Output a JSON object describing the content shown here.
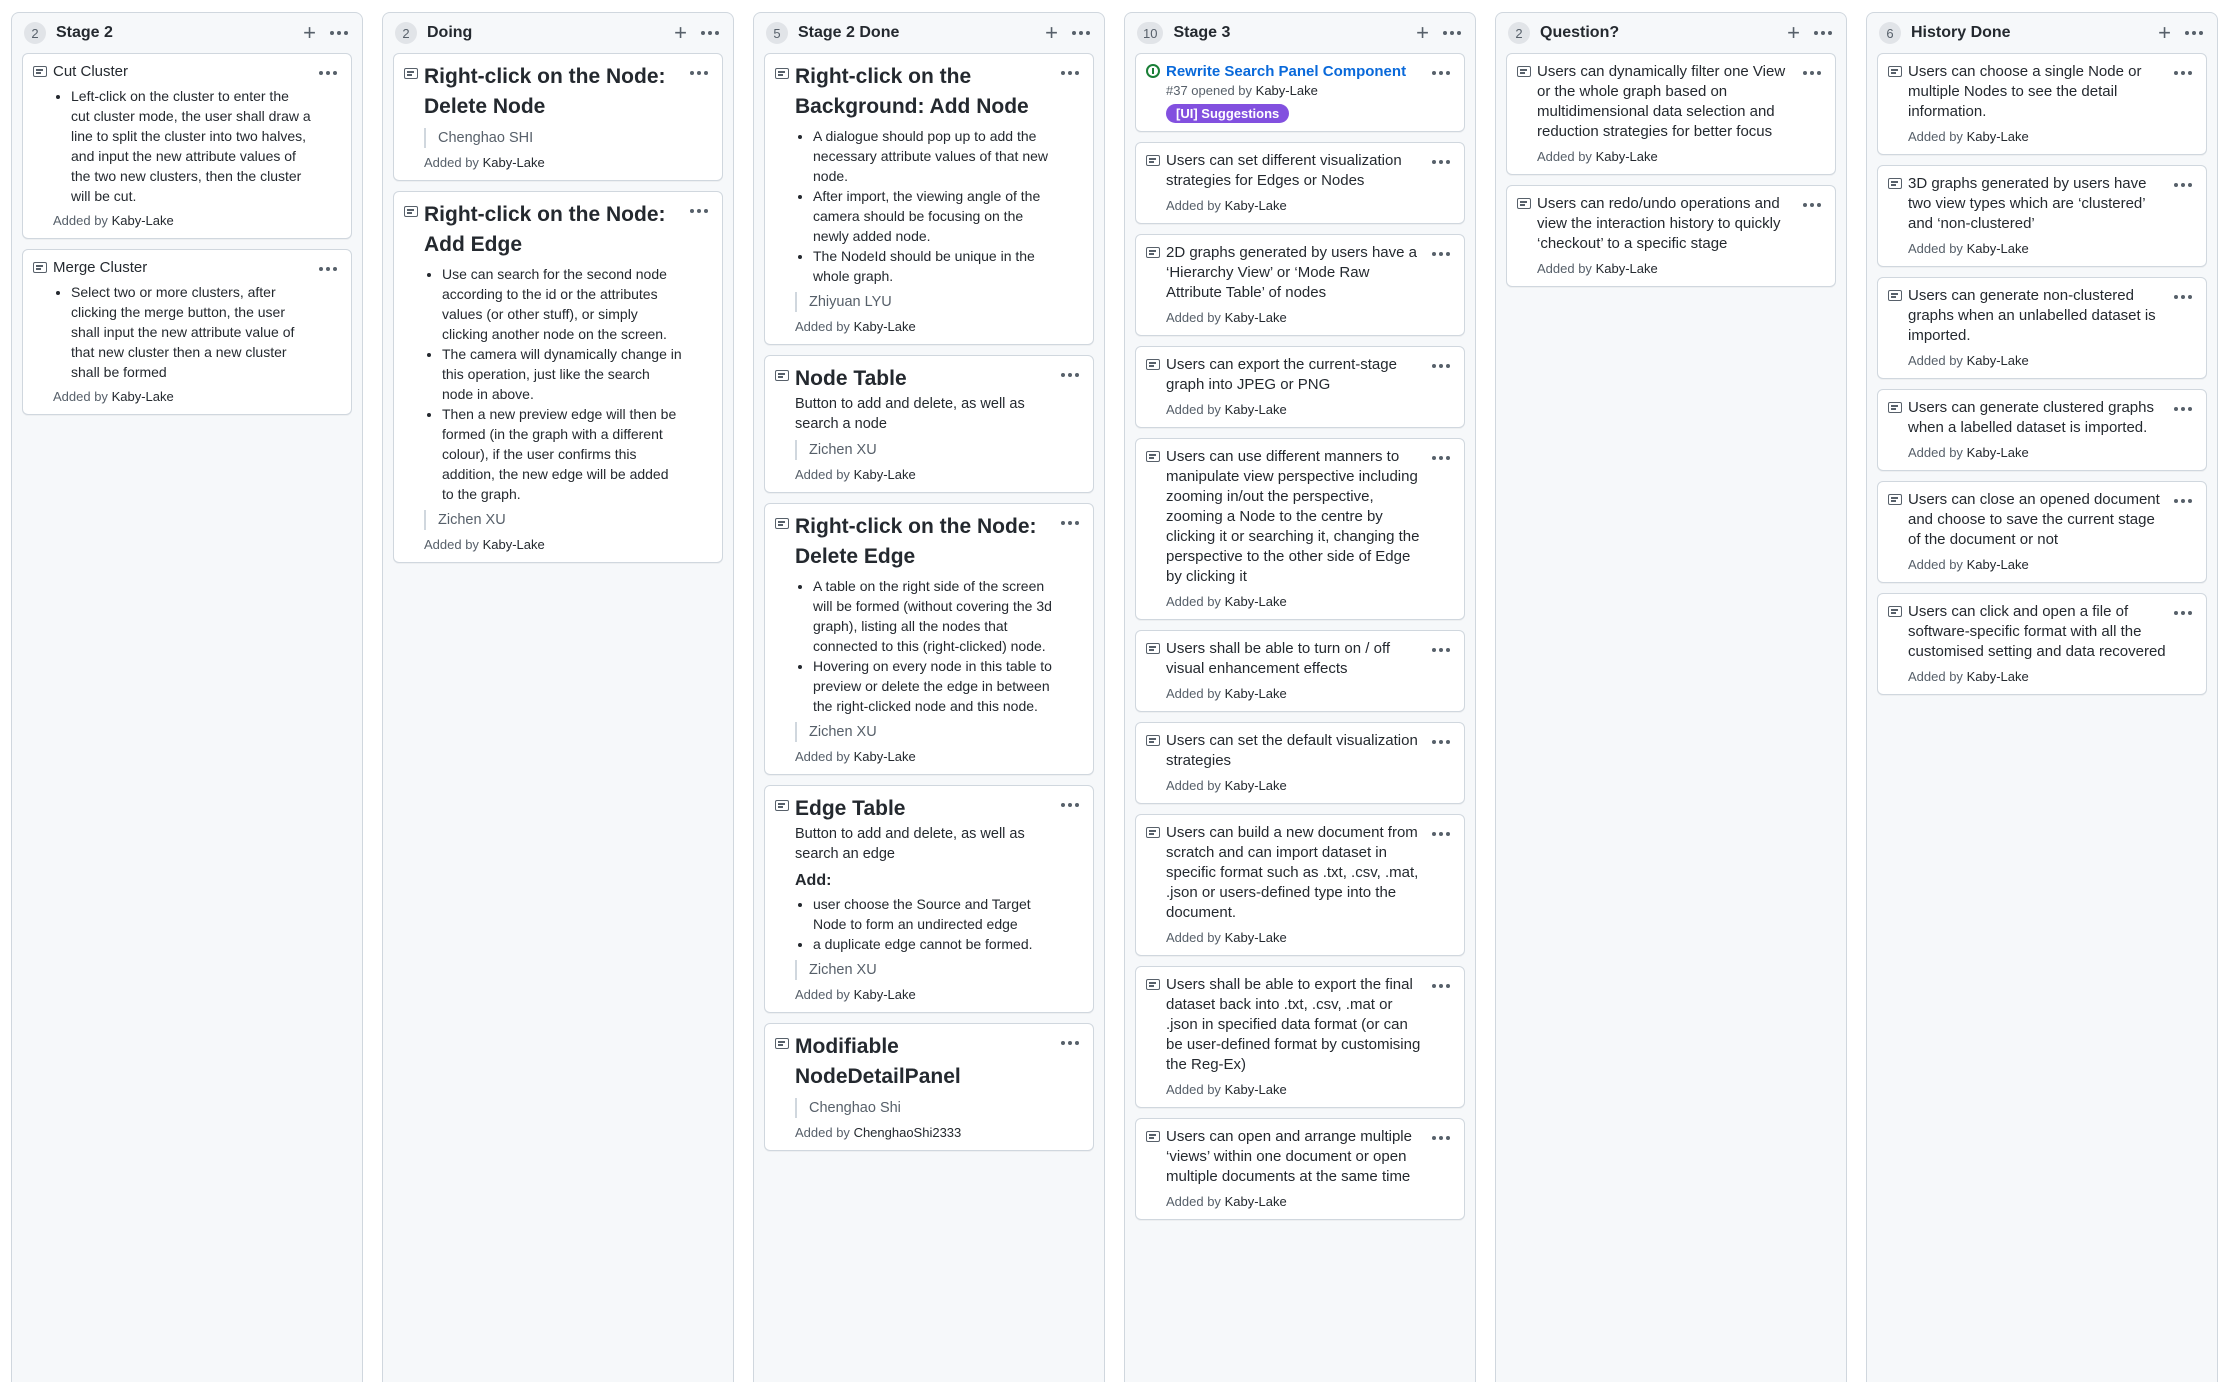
{
  "columns": [
    {
      "title": "Stage 2",
      "count": "2",
      "cards": [
        {
          "title": "Cut Cluster",
          "bullets": [
            "Left-click on the cluster to enter the cut cluster mode, the user shall draw a line to split the cluster into two halves, and input the new attribute values of the two new clusters, then the cluster will be cut."
          ],
          "added_by": "Kaby-Lake"
        },
        {
          "title": "Merge Cluster",
          "bullets": [
            "Select two or more clusters, after clicking the merge button, the user shall input the new attribute value of that new cluster then a new cluster shall be formed"
          ],
          "added_by": "Kaby-Lake"
        }
      ]
    },
    {
      "title": "Doing",
      "count": "2",
      "cards": [
        {
          "big": true,
          "title": "Right-click on the Node: Delete Node",
          "author": "Chenghao SHI",
          "added_by": "Kaby-Lake"
        },
        {
          "big": true,
          "title": "Right-click on the Node: Add Edge",
          "bullets": [
            "Use can search for the second node according to the id or the attributes values (or other stuff), or simply clicking another node on the screen.",
            "The camera will dynamically change in this operation, just like the search node in above.",
            "Then a new preview edge will then be formed (in the graph with a different colour), if the user confirms this addition, the new edge will be added to the graph."
          ],
          "author": "Zichen XU",
          "added_by": "Kaby-Lake"
        }
      ]
    },
    {
      "title": "Stage 2 Done",
      "count": "5",
      "cards": [
        {
          "big": true,
          "title": "Right-click on the Background: Add Node",
          "bullets": [
            "A dialogue should pop up to add the necessary attribute values of that new node.",
            "After import, the viewing angle of the camera should be focusing on the newly added node.",
            "The NodeId should be unique in the whole graph."
          ],
          "author": "Zhiyuan LYU",
          "added_by": "Kaby-Lake"
        },
        {
          "big": true,
          "title": "Node Table",
          "text": "Button to add and delete, as well as search a node",
          "author": "Zichen XU",
          "added_by": "Kaby-Lake"
        },
        {
          "big": true,
          "title": "Right-click on the Node: Delete Edge",
          "bullets": [
            "A table on the right side of the screen will be formed (without covering the 3d graph), listing all the nodes that connected to this (right-clicked) node.",
            "Hovering on every node in this table to preview or delete the edge in between the right-clicked node and this node."
          ],
          "author": "Zichen XU",
          "added_by": "Kaby-Lake"
        },
        {
          "big": true,
          "title": "Edge Table",
          "text": "Button to add and delete, as well as search an edge",
          "sub_heading": "Add:",
          "bullets": [
            "user choose the Source and Target Node to form an undirected edge",
            "a duplicate edge cannot be formed."
          ],
          "author": "Zichen XU",
          "added_by": "Kaby-Lake"
        },
        {
          "big": true,
          "title": "Modifiable NodeDetailPanel",
          "author": "Chenghao Shi",
          "added_by": "ChenghaoShi2333"
        }
      ]
    },
    {
      "title": "Stage 3",
      "count": "10",
      "cards": [
        {
          "issue": true,
          "title": "Rewrite Search Panel Component",
          "issue_number": "#37 opened by",
          "issue_user": "Kaby-Lake",
          "label": "[UI] Suggestions"
        },
        {
          "title": "Users can set different visualization strategies for Edges or Nodes",
          "added_by": "Kaby-Lake"
        },
        {
          "title": "2D graphs generated by users have a ‘Hierarchy View’ or ‘Mode Raw Attribute Table’ of nodes",
          "added_by": "Kaby-Lake"
        },
        {
          "title": "Users can export the current-stage graph into JPEG or PNG",
          "added_by": "Kaby-Lake"
        },
        {
          "title": "Users can use different manners to manipulate view perspective including zooming in/out the perspective, zooming a Node to the centre by clicking it or searching it, changing the perspective to the other side of Edge by clicking it",
          "added_by": "Kaby-Lake"
        },
        {
          "title": "Users shall be able to turn on / off visual enhancement effects",
          "added_by": "Kaby-Lake"
        },
        {
          "title": "Users can set the default visualization strategies",
          "added_by": "Kaby-Lake"
        },
        {
          "title": "Users can build a new document from scratch and can import dataset in specific format such as .txt, .csv, .mat, .json or users-defined type into the document.",
          "added_by": "Kaby-Lake"
        },
        {
          "title": "Users shall be able to export the final dataset back into .txt, .csv, .mat or .json in specified data format (or can be user-defined format by customising the Reg-Ex)",
          "added_by": "Kaby-Lake"
        },
        {
          "title": "Users can open and arrange multiple ‘views’ within one document or open multiple documents at the same time",
          "added_by": "Kaby-Lake"
        }
      ]
    },
    {
      "title": "Question?",
      "count": "2",
      "cards": [
        {
          "title": "Users can dynamically filter one View or the whole graph based on multidimensional data selection and reduction strategies for better focus",
          "added_by": "Kaby-Lake"
        },
        {
          "title": "Users can redo/undo operations and view the interaction history to quickly ‘checkout’ to a specific stage",
          "added_by": "Kaby-Lake"
        }
      ]
    },
    {
      "title": "History Done",
      "count": "6",
      "cards": [
        {
          "title": "Users can choose a single Node or multiple Nodes to see the detail information.",
          "added_by": "Kaby-Lake"
        },
        {
          "title": "3D graphs generated by users have two view types which are ‘clustered’ and ‘non-clustered’",
          "added_by": "Kaby-Lake"
        },
        {
          "title": "Users can generate non-clustered graphs when an unlabelled dataset is imported.",
          "added_by": "Kaby-Lake"
        },
        {
          "title": "Users can generate clustered graphs when a labelled dataset is imported.",
          "added_by": "Kaby-Lake"
        },
        {
          "title": "Users can close an opened document and choose to save the current stage of the document or not",
          "added_by": "Kaby-Lake"
        },
        {
          "title": "Users can click and open a file of software-specific format with all the customised setting and data recovered",
          "added_by": "Kaby-Lake"
        }
      ]
    }
  ],
  "added_prefix": "Added by"
}
